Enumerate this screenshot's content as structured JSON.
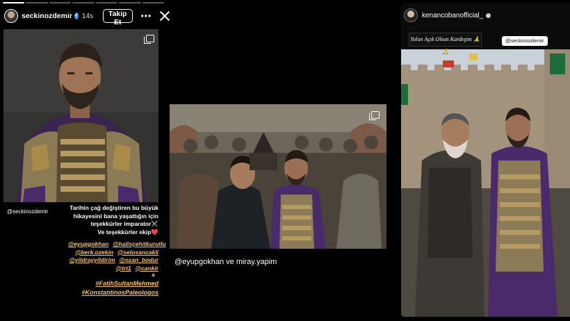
{
  "left_story": {
    "progress_segments": 7,
    "progress_done": 1,
    "username": "seckinozdemir",
    "time": "14s",
    "follow_label": "Takip Et",
    "more_icon": "more-horizontal-icon",
    "close_icon": "close-icon",
    "mention": "@seckinozdemir",
    "caption_lines": [
      "Tarihin çağ değiştiren bu büyük",
      "hikayesini bana yaşattığın için",
      "teşekkürler imparator⚔️",
      "Ve teşekkürler ekip❤️"
    ],
    "tags": [
      "@eyupgokhan",
      "@halisçehitkurutlu",
      "@berk.ozekin",
      "@selosancakli",
      "@yildrayyildirim",
      "@ozan_bodur",
      "@trt1",
      "@cankir"
    ],
    "hashtags": [
      "#FatihSultanMehmed",
      "#KonstantinosPaleologos"
    ]
  },
  "middle_story": {
    "caption": "@eyupgokhan ve miray.yapim"
  },
  "right_story": {
    "username": "kenancobanofficial_",
    "banner_text": "Yolun Açık Olsun Kardeşim 🙏🙏",
    "mention": "@seckinozdemir"
  },
  "colors": {
    "tag": "#f4c26b",
    "verified": "#3897f0",
    "armor_purple": "#4a2a6a",
    "armor_gold": "#a88a4a"
  }
}
